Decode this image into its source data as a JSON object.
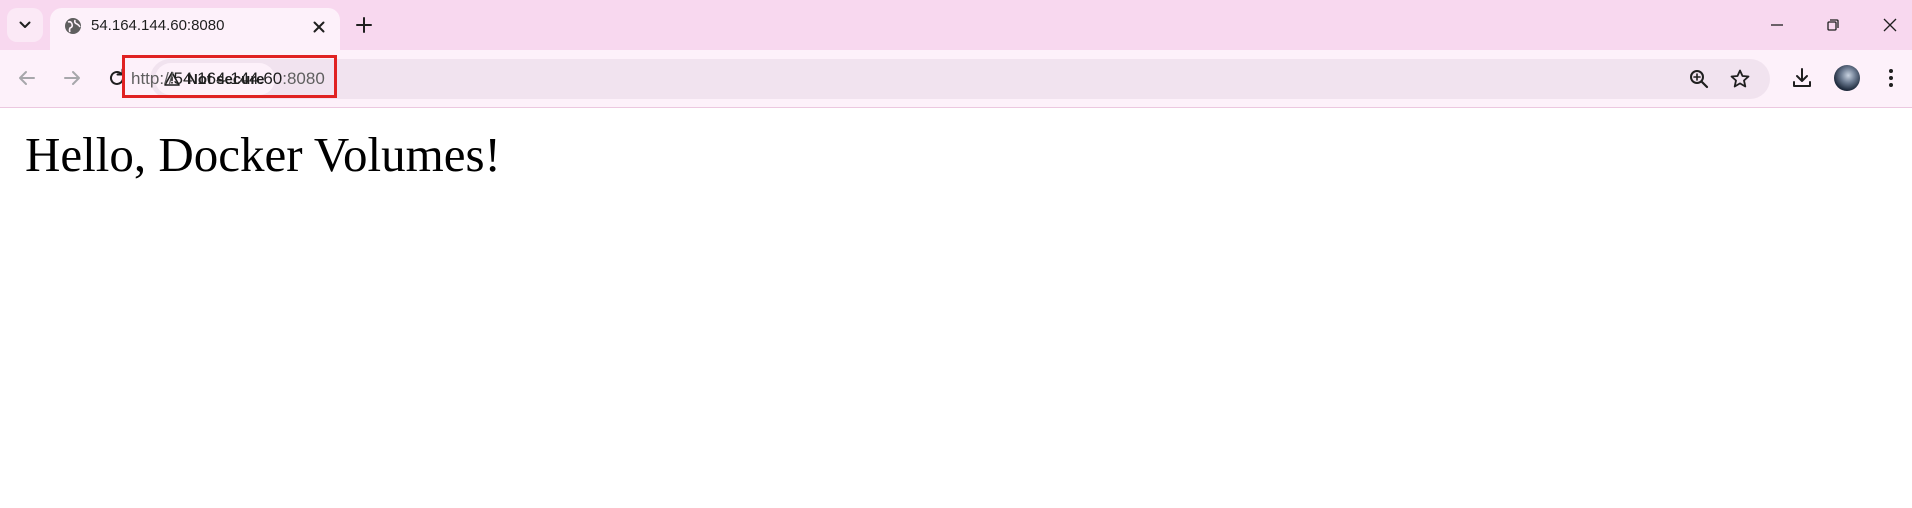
{
  "browser": {
    "tab": {
      "title": "54.164.144.60:8080"
    },
    "security": {
      "label": "Not secure"
    },
    "address": {
      "scheme": "http://",
      "host": "54.164.144.60",
      "port": ":8080"
    },
    "icons": {
      "tab_search": "chevron-down-icon",
      "favicon": "globe-icon",
      "tab_close": "close-icon",
      "new_tab": "plus-icon",
      "back": "arrow-left-icon",
      "forward": "arrow-right-icon",
      "reload": "reload-icon",
      "warning": "warning-triangle-icon",
      "zoom": "zoom-in-icon",
      "bookmark": "star-icon",
      "download": "download-icon",
      "menu": "kebab-menu-icon"
    },
    "colors": {
      "tabstrip": "#f8d8ef",
      "toolbar": "#fdf1fa",
      "omnibox": "#f1e3ef",
      "highlight": "#e02222"
    }
  },
  "page": {
    "heading": "Hello, Docker Volumes!"
  }
}
